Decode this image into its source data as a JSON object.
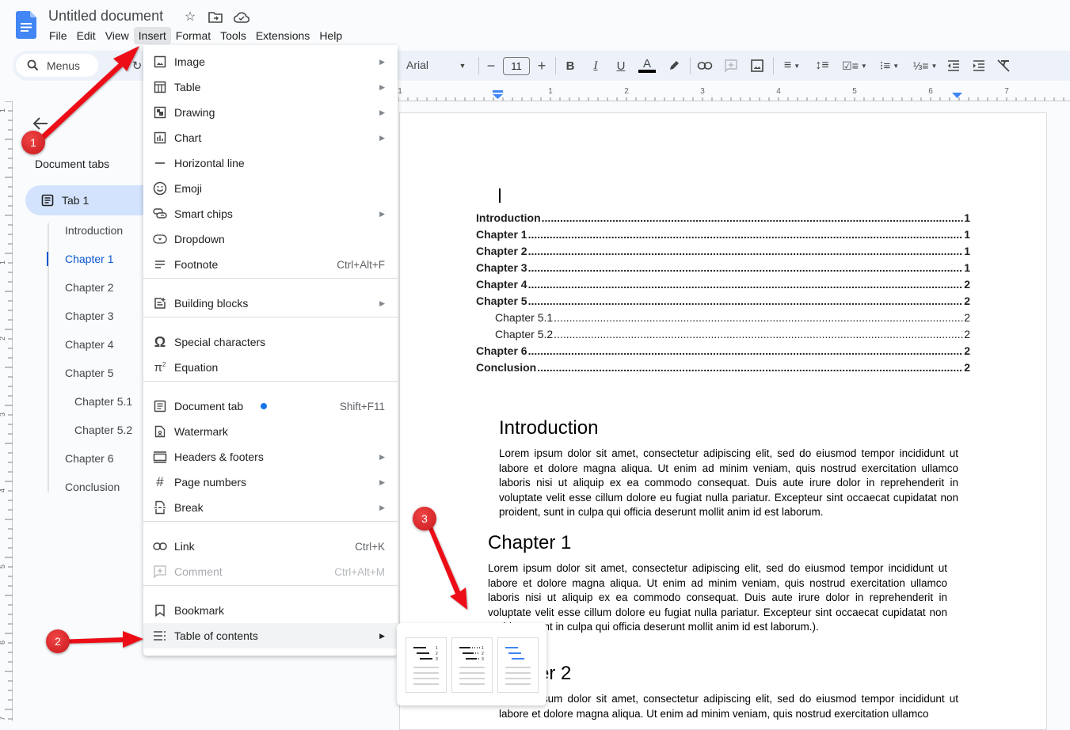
{
  "app": {
    "title": "Untitled document",
    "header_icons": [
      "star-icon",
      "move-to-folder-icon",
      "cloud-saved-icon"
    ]
  },
  "menubar": [
    "File",
    "Edit",
    "View",
    "Insert",
    "Format",
    "Tools",
    "Extensions",
    "Help"
  ],
  "toolbar": {
    "search_label": "Menus",
    "font": "Arial",
    "font_size": "11",
    "decrease_label": "−",
    "increase_label": "+",
    "bold": "B",
    "italic": "I",
    "underline": "U",
    "text_color_label": "A"
  },
  "ruler": {
    "labels": [
      "1",
      "1",
      "2",
      "3",
      "4",
      "5",
      "6",
      "7"
    ],
    "vertical_labels": [
      "1",
      "1",
      "2",
      "3",
      "4",
      "5",
      "6",
      "7"
    ]
  },
  "sidebar": {
    "title": "Document tabs",
    "tab": "Tab 1",
    "outline": [
      {
        "label": "Introduction",
        "level": 1,
        "active": false
      },
      {
        "label": "Chapter 1",
        "level": 1,
        "active": true
      },
      {
        "label": "Chapter 2",
        "level": 1,
        "active": false
      },
      {
        "label": "Chapter 3",
        "level": 1,
        "active": false
      },
      {
        "label": "Chapter 4",
        "level": 1,
        "active": false
      },
      {
        "label": "Chapter 5",
        "level": 1,
        "active": false
      },
      {
        "label": "Chapter 5.1",
        "level": 2,
        "active": false
      },
      {
        "label": "Chapter 5.2",
        "level": 2,
        "active": false
      },
      {
        "label": "Chapter 6",
        "level": 1,
        "active": false
      },
      {
        "label": "Conclusion",
        "level": 1,
        "active": false
      }
    ]
  },
  "insert_menu": {
    "items": [
      {
        "label": "Image",
        "icon": "image-icon",
        "submenu": true
      },
      {
        "label": "Table",
        "icon": "table-icon",
        "submenu": true
      },
      {
        "label": "Drawing",
        "icon": "drawing-icon",
        "submenu": true
      },
      {
        "label": "Chart",
        "icon": "chart-icon",
        "submenu": true
      },
      {
        "label": "Horizontal line",
        "icon": "horizontal-line-icon"
      },
      {
        "label": "Emoji",
        "icon": "emoji-icon"
      },
      {
        "label": "Smart chips",
        "icon": "smart-chips-icon",
        "submenu": true
      },
      {
        "label": "Dropdown",
        "icon": "dropdown-icon"
      },
      {
        "label": "Footnote",
        "icon": "footnote-icon",
        "shortcut": "Ctrl+Alt+F"
      },
      {
        "label": "Building blocks",
        "icon": "building-blocks-icon",
        "submenu": true
      },
      {
        "label": "Special characters",
        "icon": "omega-icon"
      },
      {
        "label": "Equation",
        "icon": "pi-icon"
      },
      {
        "label": "Document tab",
        "icon": "document-tab-icon",
        "shortcut": "Shift+F11",
        "new_badge": true
      },
      {
        "label": "Watermark",
        "icon": "watermark-icon"
      },
      {
        "label": "Headers & footers",
        "icon": "headers-footers-icon",
        "submenu": true
      },
      {
        "label": "Page numbers",
        "icon": "hash-icon",
        "submenu": true
      },
      {
        "label": "Break",
        "icon": "break-icon",
        "submenu": true
      },
      {
        "label": "Link",
        "icon": "link-icon",
        "shortcut": "Ctrl+K"
      },
      {
        "label": "Comment",
        "icon": "comment-icon",
        "shortcut": "Ctrl+Alt+M",
        "disabled": true
      },
      {
        "label": "Bookmark",
        "icon": "bookmark-icon"
      },
      {
        "label": "Table of contents",
        "icon": "toc-icon",
        "submenu": true,
        "highlighted": true
      }
    ]
  },
  "toc_submenu": {
    "options": [
      "plain-text-toc",
      "dotted-toc",
      "links-toc"
    ],
    "accent": "#4285f4"
  },
  "document": {
    "toc": [
      {
        "label": "Introduction",
        "page": "1",
        "level": 1
      },
      {
        "label": "Chapter 1",
        "page": "1",
        "level": 1
      },
      {
        "label": "Chapter 2",
        "page": "1",
        "level": 1
      },
      {
        "label": "Chapter 3",
        "page": "1",
        "level": 1
      },
      {
        "label": "Chapter 4",
        "page": "2",
        "level": 1
      },
      {
        "label": "Chapter 5",
        "page": "2",
        "level": 1
      },
      {
        "label": "Chapter 5.1",
        "page": "2",
        "level": 2
      },
      {
        "label": "Chapter 5.2",
        "page": "2",
        "level": 2
      },
      {
        "label": "Chapter 6",
        "page": "2",
        "level": 1
      },
      {
        "label": "Conclusion",
        "page": "2",
        "level": 1
      }
    ],
    "sections": [
      {
        "heading": "Introduction",
        "body": "Lorem ipsum dolor sit amet, consectetur adipiscing elit, sed do eiusmod tempor incididunt ut labore et dolore magna aliqua. Ut enim ad minim veniam, quis nostrud exercitation ullamco laboris nisi ut aliquip ex ea commodo consequat. Duis aute irure dolor in reprehenderit in voluptate velit esse cillum dolore eu fugiat nulla pariatur. Excepteur sint occaecat cupidatat non proident, sunt in culpa qui officia deserunt mollit anim id est laborum."
      },
      {
        "heading": "Chapter 1",
        "body": "Lorem ipsum dolor sit amet, consectetur adipiscing elit, sed do eiusmod tempor incididunt ut labore et dolore magna aliqua. Ut enim ad minim veniam, quis nostrud exercitation ullamco laboris nisi ut aliquip ex ea commodo consequat. Duis aute irure dolor in reprehenderit in voluptate velit esse cillum dolore eu fugiat nulla pariatur. Excepteur sint occaecat cupidatat non proident, sunt in culpa qui officia deserunt mollit anim id est laborum.)."
      },
      {
        "heading": "Chapter 2",
        "body": "Lorem ipsum dolor sit amet, consectetur adipiscing elit, sed do eiusmod tempor incididunt ut labore et dolore magna aliqua. Ut enim ad minim veniam, quis nostrud exercitation ullamco"
      }
    ]
  },
  "annotations": {
    "badges": [
      "1",
      "2",
      "3"
    ],
    "color": "#e8121a"
  }
}
